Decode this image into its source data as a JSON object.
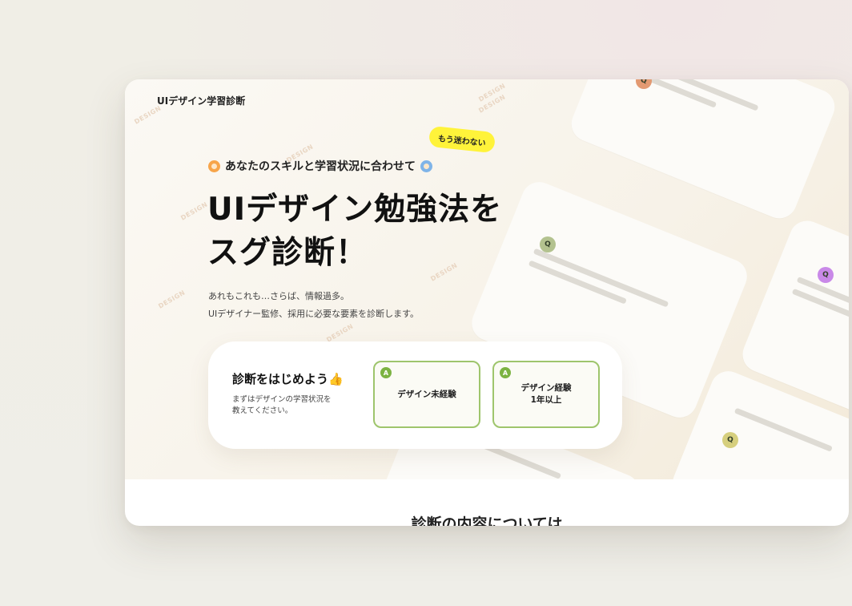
{
  "site": {
    "logo_text": "UIデザイン学習診断"
  },
  "hero": {
    "badge": "もう迷わない",
    "lead": "あなたのスキルと学習状況に合わせて",
    "headline_line1": "UIデザイン勉強法を",
    "headline_line2": "スグ診断！",
    "sub_line1": "あれもこれも…さらば、情報過多。",
    "sub_line2": "UIデザイナー監修、採用に必要な要素を診断します。",
    "background_pin_label": "Q",
    "background_watermark": "DESIGN"
  },
  "start_card": {
    "title": "診断をはじめよう👍",
    "desc_line1": "まずはデザインの学習状況を",
    "desc_line2": "教えてください。",
    "choices": [
      {
        "badge": "A",
        "label_line1": "デザイン未経験",
        "label_line2": ""
      },
      {
        "badge": "A",
        "label_line1": "デザイン経験",
        "label_line2": "1年以上"
      }
    ]
  },
  "section": {
    "title": "診断の内容については"
  },
  "colors": {
    "accent_green": "#7cb342",
    "choice_border": "#9ec56c",
    "badge_yellow": "#fff33a",
    "pin_orange": "#e39a72",
    "pin_green": "#b3c28f",
    "pin_purple": "#c989e8",
    "pin_yellow": "#d6cf7e"
  }
}
